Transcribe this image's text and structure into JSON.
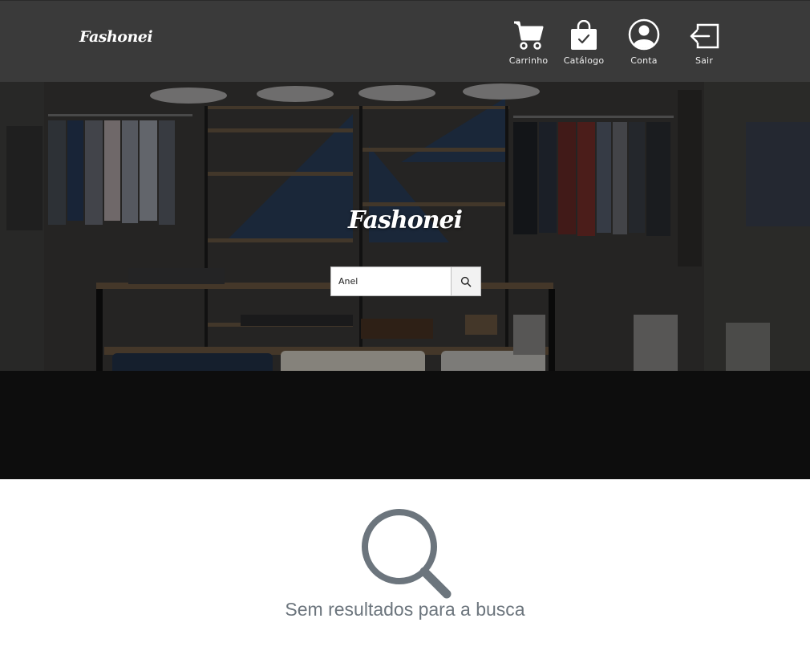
{
  "header": {
    "brand": "Fashonei",
    "nav": [
      {
        "label": "Carrinho",
        "icon": "cart-icon"
      },
      {
        "label": "Catálogo",
        "icon": "shopping-bag-check-icon"
      },
      {
        "label": "Conta",
        "icon": "user-circle-icon"
      },
      {
        "label": "Sair",
        "icon": "logout-icon"
      }
    ]
  },
  "hero": {
    "title": "Fashonei",
    "search": {
      "value": "Anel",
      "button_icon": "search-icon"
    }
  },
  "results": {
    "icon": "magnifier-icon",
    "message": "Sem resultados para a busca"
  },
  "colors": {
    "header_bg": "#3a3a3a",
    "empty_icon": "#6c757d",
    "empty_text": "#6c757d"
  }
}
